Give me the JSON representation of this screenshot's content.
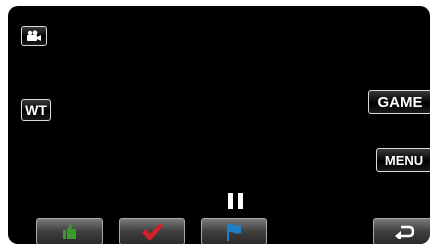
{
  "screen": {
    "mode_icon": "video-camera-icon",
    "wt_label": "WT",
    "game_label": "GAME",
    "menu_label": "MENU",
    "status_icon": "pause-icon"
  },
  "bottom_bar": {
    "icons": [
      "thumbs-up-icon",
      "checkmark-icon",
      "flag-icon",
      "return-icon"
    ],
    "colors": {
      "thumbs_up": "#3a9a2a",
      "checkmark": "#d3212b",
      "flag": "#1f7fc4"
    }
  }
}
